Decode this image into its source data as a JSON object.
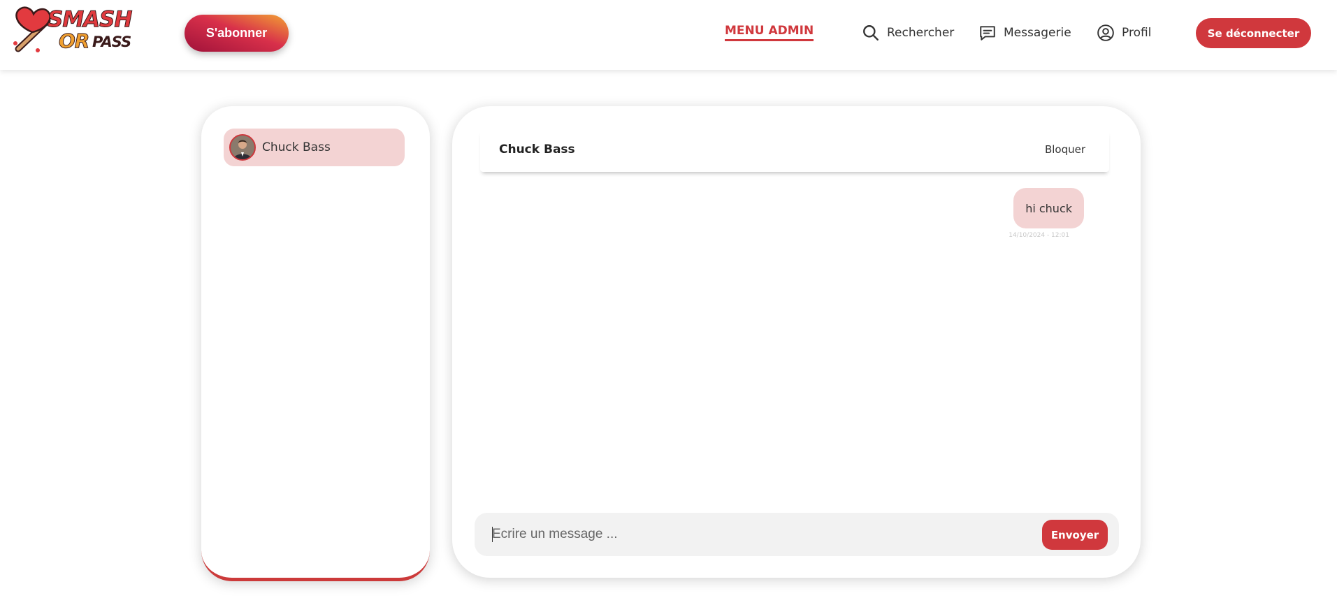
{
  "brand": {
    "logo_words": [
      "SMASH",
      "OR",
      "PASS"
    ]
  },
  "header": {
    "subscribe_label": "S'abonner",
    "admin_menu_label": "MENU ADMIN",
    "nav": [
      {
        "label": "Rechercher",
        "icon": "search-icon"
      },
      {
        "label": "Messagerie",
        "icon": "chat-bubble-icon"
      },
      {
        "label": "Profil",
        "icon": "user-circle-icon"
      }
    ],
    "logout_label": "Se déconnecter"
  },
  "conversations": [
    {
      "name": "Chuck Bass",
      "selected": true
    }
  ],
  "chat": {
    "contact_name": "Chuck Bass",
    "block_label": "Bloquer",
    "messages": [
      {
        "text": "hi chuck",
        "timestamp": "14/10/2024 - 12:01",
        "from_me": true
      }
    ],
    "input_placeholder": "Ecrire un message ...",
    "send_label": "Envoyer"
  },
  "colors": {
    "accent": "#d0383d",
    "bubble": "#f3d3d3",
    "composer_bg": "#f2f2f2"
  }
}
